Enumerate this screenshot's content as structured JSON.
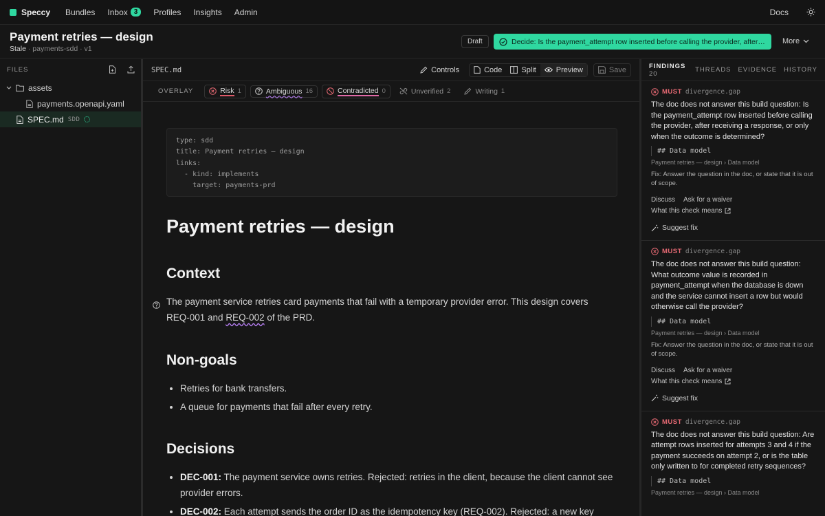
{
  "nav": {
    "brand": "Speccy",
    "links": [
      "Bundles",
      "Inbox",
      "Profiles",
      "Insights",
      "Admin"
    ],
    "inbox_count": "3",
    "docs": "Docs"
  },
  "doc": {
    "title": "Payment retries — design",
    "status": "Stale",
    "subtitle": "· payments-sdd · v1",
    "draft": "Draft",
    "decide": "Decide: Is the payment_attempt row inserted before calling the provider, after ...",
    "more": "More"
  },
  "sidebar": {
    "heading": "FILES",
    "folder": "assets",
    "file1": "payments.openapi.yaml",
    "file2": "SPEC.md",
    "file2_tag": "SDD"
  },
  "editor": {
    "filename": "SPEC.md",
    "controls": "Controls",
    "code": "Code",
    "split": "Split",
    "preview": "Preview",
    "save": "Save"
  },
  "overlay": {
    "label": "OVERLAY",
    "risk": "Risk",
    "risk_count": "1",
    "ambiguous": "Ambiguous",
    "ambiguous_count": "16",
    "contradicted": "Contradicted",
    "contradicted_count": "0",
    "unverified": "Unverified",
    "unverified_count": "2",
    "writing": "Writing",
    "writing_count": "1"
  },
  "content": {
    "frontmatter": "type: sdd\ntitle: Payment retries — design\nlinks:\n  - kind: implements\n    target: payments-prd",
    "h1": "Payment retries — design",
    "context_h": "Context",
    "context_p1": "The payment service retries card payments that fail with a temporary provider error. This design covers REQ-001 and ",
    "context_req": "REQ-002",
    "context_p2": " of the PRD.",
    "nongoals_h": "Non-goals",
    "nongoals": [
      "Retries for bank transfers.",
      "A queue for payments that fail after every retry."
    ],
    "decisions_h": "Decisions",
    "dec1_id": "DEC-001:",
    "dec1_text": " The payment service owns retries. Rejected: retries in the client, because the client cannot see provider errors.",
    "dec2_id": "DEC-002:",
    "dec2_text": " Each attempt sends the order ID as the idempotency key (REQ-002). Rejected: a new key"
  },
  "panel": {
    "tab_findings": "FINDINGS",
    "findings_count": "20",
    "tab_threads": "THREADS",
    "tab_evidence": "EVIDENCE",
    "tab_history": "HISTORY",
    "findings": [
      {
        "severity": "MUST",
        "code": "divergence.gap",
        "text": "The doc does not answer this build question: Is the payment_attempt row inserted before calling the provider, after receiving a response, or only when the outcome is determined?",
        "quote": "## Data model",
        "path": "Payment retries — design › Data model",
        "fix": "Fix: Answer the question in the doc, or state that it is out of scope.",
        "discuss": "Discuss",
        "waiver": "Ask for a waiver",
        "meaning": "What this check means",
        "suggest": "Suggest fix"
      },
      {
        "severity": "MUST",
        "code": "divergence.gap",
        "text": "The doc does not answer this build question: What outcome value is recorded in payment_attempt when the database is down and the service cannot insert a row but would otherwise call the provider?",
        "quote": "## Data model",
        "path": "Payment retries — design › Data model",
        "fix": "Fix: Answer the question in the doc, or state that it is out of scope.",
        "discuss": "Discuss",
        "waiver": "Ask for a waiver",
        "meaning": "What this check means",
        "suggest": "Suggest fix"
      },
      {
        "severity": "MUST",
        "code": "divergence.gap",
        "text": "The doc does not answer this build question: Are attempt rows inserted for attempts 3 and 4 if the payment succeeds on attempt 2, or is the table only written to for completed retry sequences?",
        "quote": "## Data model",
        "path": "Payment retries — design › Data model",
        "fix": "",
        "discuss": "",
        "waiver": "",
        "meaning": "",
        "suggest": ""
      }
    ]
  },
  "colors": {
    "accent": "#2fd8a0",
    "must": "#e86a74",
    "background": "#161616"
  }
}
